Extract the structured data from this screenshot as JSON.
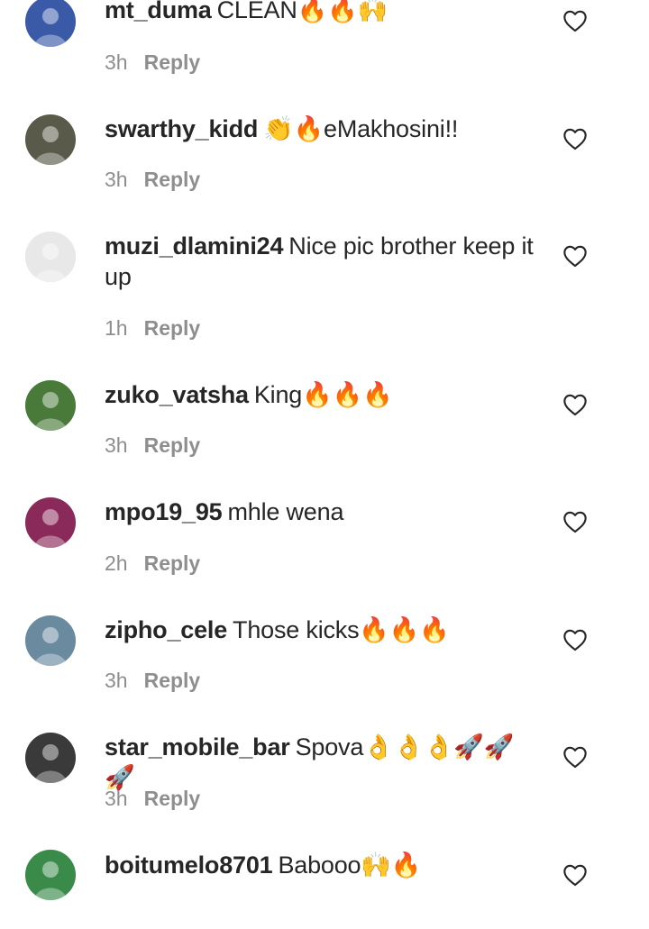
{
  "comments": [
    {
      "username": "mt_duma",
      "text": "CLEAN🔥🔥🙌",
      "time": "3h",
      "reply": "Reply",
      "avatar_color": "#3a5aa8"
    },
    {
      "username": "swarthy_kidd",
      "text": "👏🔥eMakhosini!!",
      "time": "3h",
      "reply": "Reply",
      "avatar_color": "#5a5a4a"
    },
    {
      "username": "muzi_dlamini24",
      "text": "Nice pic brother keep it up",
      "time": "1h",
      "reply": "Reply",
      "avatar_color": "#e8e8e8"
    },
    {
      "username": "zuko_vatsha",
      "text": "King🔥🔥🔥",
      "time": "3h",
      "reply": "Reply",
      "avatar_color": "#4a7a3a"
    },
    {
      "username": "mpo19_95",
      "text": "mhle wena",
      "time": "2h",
      "reply": "Reply",
      "avatar_color": "#8a2a5a"
    },
    {
      "username": "zipho_cele",
      "text": "Those kicks🔥🔥🔥",
      "time": "3h",
      "reply": "Reply",
      "avatar_color": "#6a8aa0"
    },
    {
      "username": "star_mobile_bar",
      "text": "Spova👌👌👌🚀🚀🚀",
      "time": "3h",
      "reply": "Reply",
      "avatar_color": "#3a3a3a"
    },
    {
      "username": "boitumelo8701",
      "text": "Babooo🙌🔥",
      "time": "",
      "reply": "",
      "avatar_color": "#3a8a4a"
    }
  ],
  "icons": {
    "like": "heart-outline-icon"
  }
}
